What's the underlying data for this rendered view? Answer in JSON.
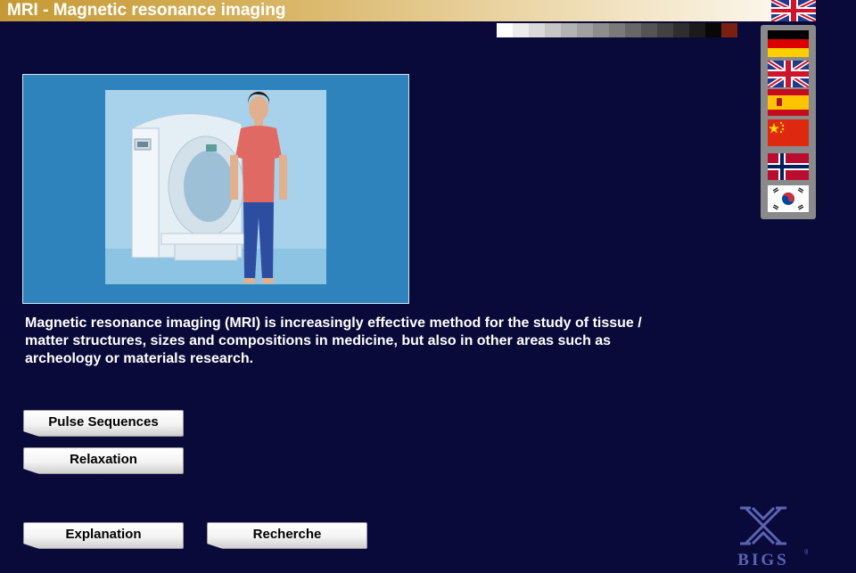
{
  "header": {
    "title": "MRI - Magnetic resonance imaging"
  },
  "flags": {
    "top": "uk-flag-icon",
    "languages": [
      "german-flag-icon",
      "uk-flag-icon",
      "spanish-flag-icon",
      "chinese-flag-icon",
      "norwegian-flag-icon",
      "korean-flag-icon"
    ]
  },
  "main": {
    "description": "Magnetic resonance imaging (MRI) is increasingly effective method for the study of tissue / matter structures, sizes and compositions in medicine, but also in other areas such as archeology or materials research."
  },
  "buttons": {
    "pulse_sequences": "Pulse Sequences",
    "relaxation": "Relaxation",
    "explanation": "Explanation",
    "recherche": "Recherche"
  },
  "logo": {
    "text": "BIGS",
    "registered": "®"
  }
}
